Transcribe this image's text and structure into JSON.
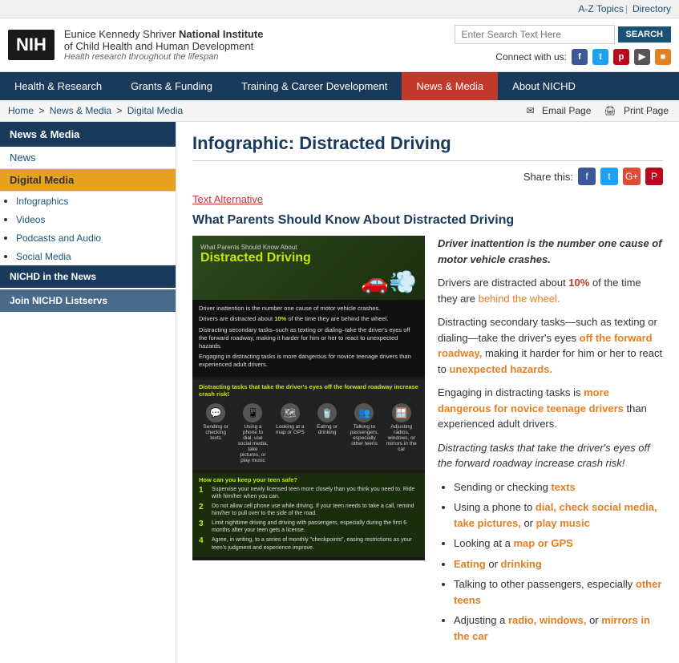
{
  "topbar": {
    "az_topics": "A-Z Topics",
    "divider": "|",
    "directory": "Directory"
  },
  "header": {
    "org_line1_plain": "Eunice Kennedy Shriver",
    "org_line1_bold": "National Institute",
    "org_line2": "of Child Health and Human Development",
    "tagline": "Health research throughout the lifespan",
    "search_placeholder": "Enter Search Text Here",
    "search_btn": "SEARCH",
    "connect_label": "Connect with us:",
    "nih_logo": "NIH"
  },
  "nav": {
    "items": [
      {
        "label": "Health & Research",
        "active": false
      },
      {
        "label": "Grants & Funding",
        "active": false
      },
      {
        "label": "Training & Career Development",
        "active": false
      },
      {
        "label": "News & Media",
        "active": true
      },
      {
        "label": "About NICHD",
        "active": false
      }
    ]
  },
  "breadcrumb": {
    "home": "Home",
    "news_media": "News & Media",
    "digital_media": "Digital Media",
    "email_page": "Email Page",
    "print_page": "Print Page"
  },
  "sidebar": {
    "section_title": "News & Media",
    "news_label": "News",
    "digital_media_label": "Digital Media",
    "sub_items": [
      {
        "label": "Infographics"
      },
      {
        "label": "Videos"
      },
      {
        "label": "Podcasts and Audio"
      },
      {
        "label": "Social Media"
      }
    ],
    "nichd_news": "NICHD in the News",
    "join_listservs": "Join NICHD Listservs"
  },
  "main": {
    "page_title": "Infographic: Distracted Driving",
    "share_label": "Share this:",
    "text_alt_link": "Text Alternative",
    "section_heading": "What Parents Should Know About Distracted Driving",
    "body_paragraphs": [
      {
        "id": "p1",
        "text": "Driver inattention is the number one cause of motor vehicle crashes."
      },
      {
        "id": "p2",
        "parts": [
          {
            "text": "Drivers are distracted about ",
            "style": ""
          },
          {
            "text": "10%",
            "style": "bold red"
          },
          {
            "text": " of the time they are ",
            "style": ""
          },
          {
            "text": "behind the wheel.",
            "style": "orange"
          }
        ]
      },
      {
        "id": "p3",
        "parts": [
          {
            "text": "Distracting secondary tasks—such as texting or dialing—take the driver's eyes ",
            "style": ""
          },
          {
            "text": "off the forward roadway,",
            "style": "bold orange"
          },
          {
            "text": " making it harder for him or her to react to ",
            "style": ""
          },
          {
            "text": "unexpected hazards.",
            "style": "bold orange"
          }
        ]
      },
      {
        "id": "p4",
        "parts": [
          {
            "text": "Engaging in distracting tasks is ",
            "style": ""
          },
          {
            "text": "more dangerous for novice teenage drivers",
            "style": "bold orange"
          },
          {
            "text": " than experienced adult drivers.",
            "style": ""
          }
        ]
      },
      {
        "id": "p5",
        "text": "Distracting tasks that take the driver's eyes off the forward roadway increase crash risk!",
        "style": "italic"
      }
    ],
    "bullet_list": [
      {
        "parts": [
          {
            "text": "Sending or checking ",
            "style": ""
          },
          {
            "text": "texts",
            "style": "bold orange"
          }
        ]
      },
      {
        "parts": [
          {
            "text": "Using a phone to ",
            "style": ""
          },
          {
            "text": "dial, check social media, take pictures,",
            "style": "bold orange"
          },
          {
            "text": " or ",
            "style": ""
          },
          {
            "text": "play music",
            "style": "bold orange"
          }
        ]
      },
      {
        "parts": [
          {
            "text": "Looking at a ",
            "style": ""
          },
          {
            "text": "map or GPS",
            "style": "bold orange"
          }
        ]
      },
      {
        "parts": [
          {
            "text": "Eating ",
            "style": "bold orange"
          },
          {
            "text": "or ",
            "style": ""
          },
          {
            "text": "drinking",
            "style": "bold orange"
          }
        ]
      },
      {
        "parts": [
          {
            "text": "Talking to other passengers, especially ",
            "style": ""
          },
          {
            "text": "other teens",
            "style": "bold orange"
          }
        ]
      },
      {
        "parts": [
          {
            "text": "Adjusting a ",
            "style": ""
          },
          {
            "text": "radio, windows,",
            "style": "bold orange"
          },
          {
            "text": " or ",
            "style": ""
          },
          {
            "text": "mirrors in the car",
            "style": "bold orange"
          }
        ]
      }
    ]
  },
  "infographic": {
    "header_small": "What Parents Should Know About",
    "header_big": "Distracted Driving",
    "p1": "Driver inattention is the number one cause of motor vehicle crashes.",
    "p2_pre": "Drivers are distracted about ",
    "p2_pct": "10%",
    "p2_post": " of the time they are behind the wheel.",
    "p3": "Distracting secondary tasks–such as texting or dialing–take the driver's eyes off the forward roadway, making it harder for him or her to react to unexpected hazards.",
    "p4": "Engaging in distracting tasks is more dangerous for novice teenage drivers than experienced adult drivers.",
    "section1_title": "Distracting tasks that take the driver's eyes off the forward roadway increase crash risk!",
    "icons": [
      {
        "glyph": "💬",
        "label": "Sending or checking texts"
      },
      {
        "glyph": "📱",
        "label": "Using a phone to dial, use social media, take pictures, or play music"
      },
      {
        "glyph": "🗺",
        "label": "Looking at a map or GPS"
      },
      {
        "glyph": "🥤",
        "label": "Eating or drinking"
      },
      {
        "glyph": "👥",
        "label": "Talking to passengers, especially other teens"
      },
      {
        "glyph": "🪟",
        "label": "Adjusting radios, windows, or mirrors in the car"
      }
    ],
    "section2_title": "How can you keep your teen safe?",
    "teen_tips": [
      "Supervise your newly licensed teen more closely than you think you need to. Ride with him/her when you can.",
      "Do not allow cell phone use while driving. If your teen needs to take a call, remind him/her to pull over to the side of the road.",
      "Limit nighttime driving and driving with passengers, especially during the first 6 months after your teen gets a license.",
      "Agree, in writing, to a series of monthly \"checkpoints\", easing restrictions as your teen's judgment and experience improve."
    ]
  }
}
